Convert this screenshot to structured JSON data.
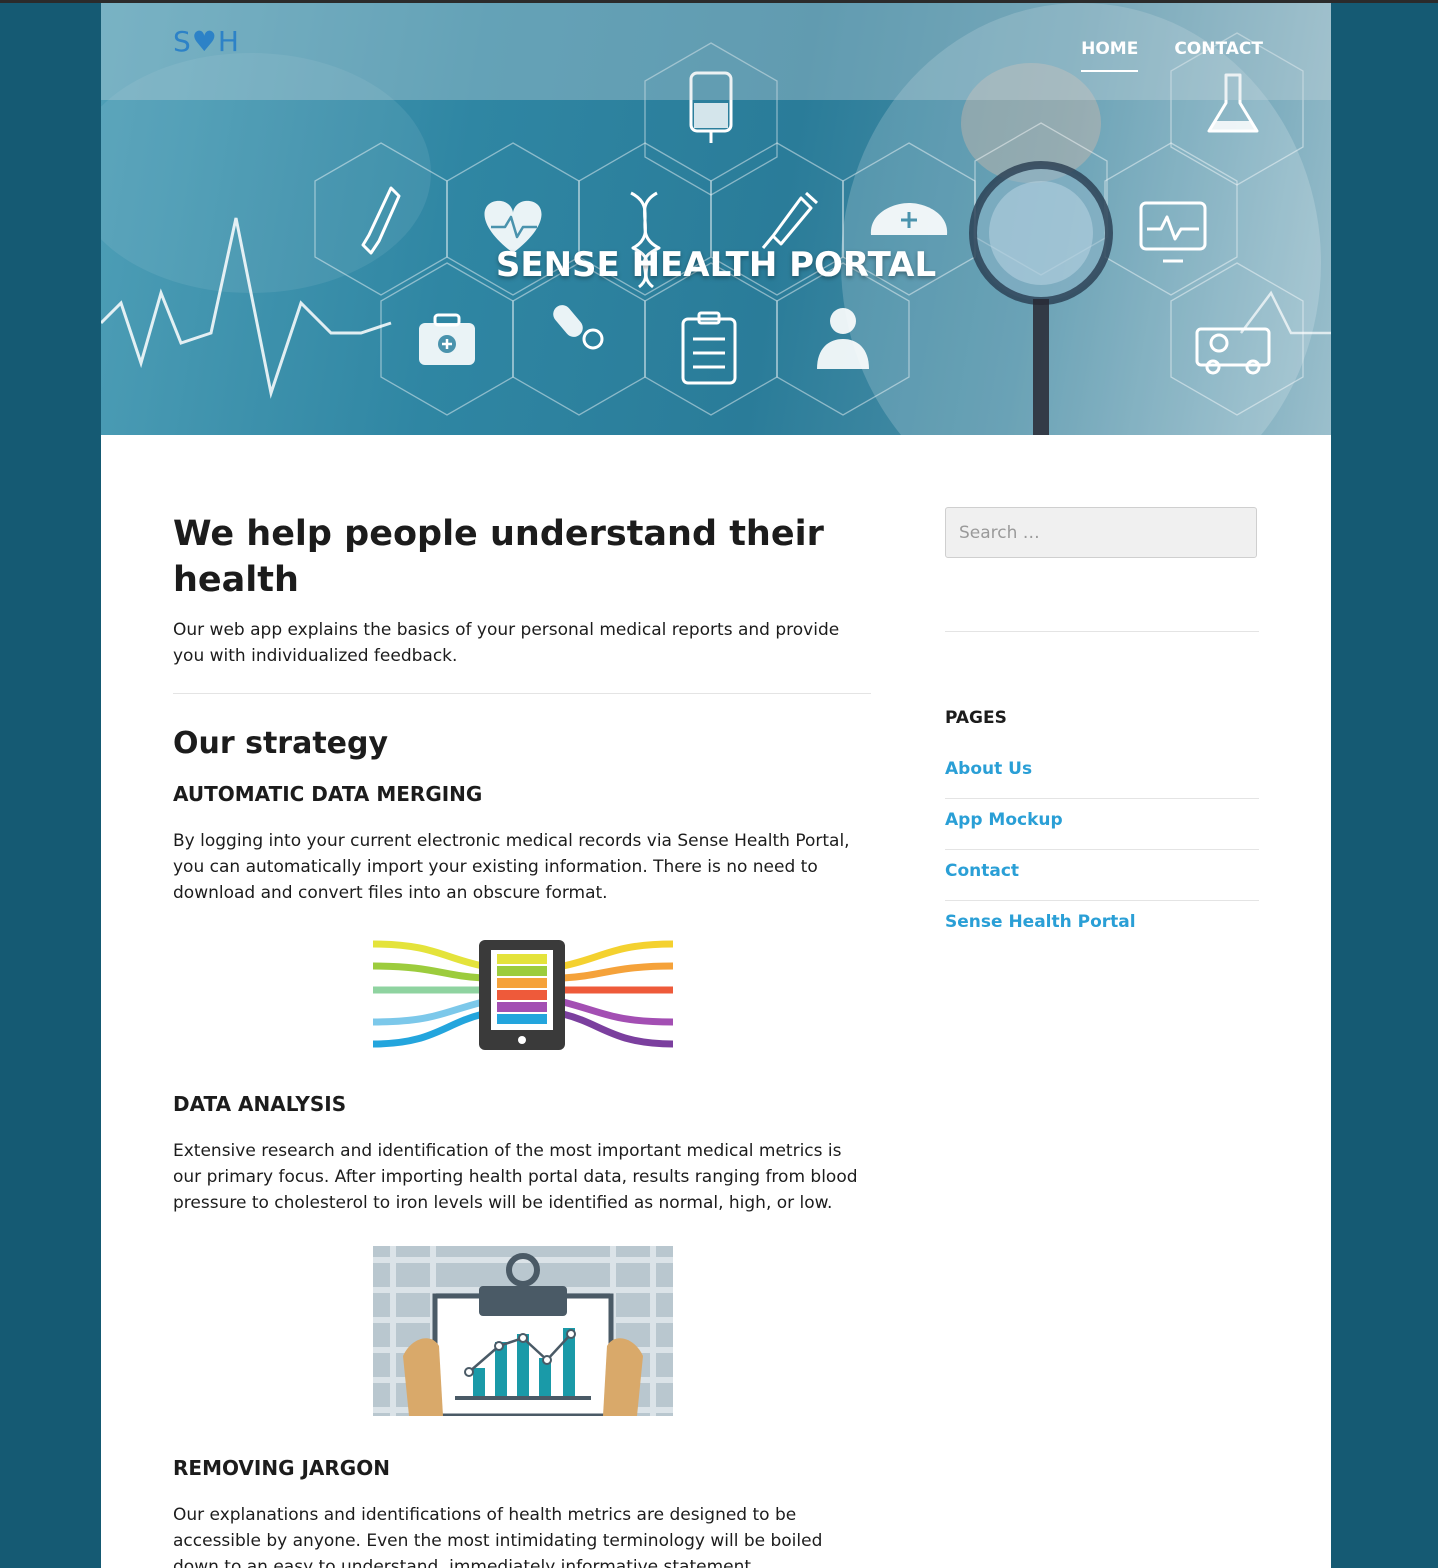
{
  "header": {
    "logo_text": "S♥H",
    "nav": [
      {
        "label": "HOME",
        "active": true
      },
      {
        "label": "CONTACT",
        "active": false
      }
    ],
    "site_title": "SENSE HEALTH PORTAL"
  },
  "main": {
    "intro_heading": "We help people understand their health",
    "intro_text": "Our web app explains the basics of your personal medical reports and provide you with individualized feedback.",
    "strategy_heading": "Our strategy",
    "sections": [
      {
        "heading": "AUTOMATIC DATA MERGING",
        "text": "By logging into your current electronic medical records via Sense Health Portal, you can automatically import your existing information. There is no need to download and convert files into an obscure format."
      },
      {
        "heading": "DATA ANALYSIS",
        "text": "Extensive research and identification of the most important medical metrics is our primary focus. After importing health portal data, results ranging from blood pressure to cholesterol to iron levels will be identified as normal, high, or low."
      },
      {
        "heading": "REMOVING JARGON",
        "text": "Our explanations and identifications of health metrics are designed to be accessible by anyone. Even the most intimidating terminology will be boiled down to an easy to understand, immediately informative statement."
      }
    ]
  },
  "sidebar": {
    "search_placeholder": "Search …",
    "pages_title": "PAGES",
    "pages": [
      "About Us",
      "App Mockup",
      "Contact",
      "Sense Health Portal"
    ]
  },
  "colors": {
    "background": "#155a73",
    "link": "#2a9fd6",
    "logo": "#2d82c7"
  },
  "icons": [
    "heart-icon",
    "dna-icon",
    "syringe-icon",
    "dropper-icon",
    "iv-bag-icon",
    "flask-icon",
    "nurse-cap-icon",
    "monitor-icon",
    "first-aid-kit-icon",
    "pills-icon",
    "clipboard-icon",
    "doctor-icon",
    "ambulance-icon",
    "stethoscope-icon"
  ]
}
